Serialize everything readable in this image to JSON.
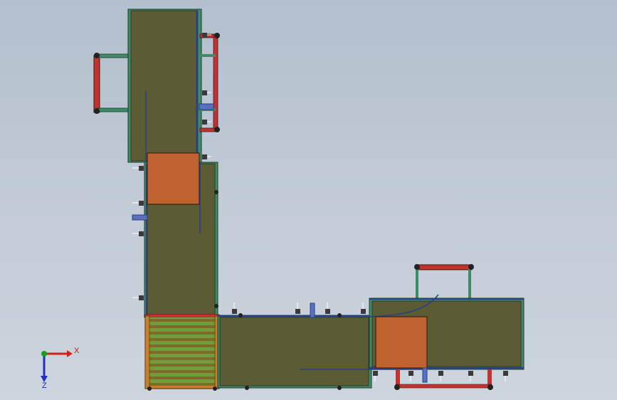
{
  "colors": {
    "background": "#bfc9d5",
    "conveyor_belt": "#5b5c33",
    "belt_edge": "#2f3a2a",
    "frame_rail": "#3f8a67",
    "side_guard": "#2a3f86",
    "transfer_pad": "#c0622f",
    "handle_frame": "#c2332f",
    "roller": "#6f9e3b",
    "roller_frame": "#c8812a",
    "axis_x": "#d62020",
    "axis_y": "#18a018",
    "axis_z": "#2030c0"
  },
  "triad": {
    "x_label": "X",
    "z_label": "Z"
  },
  "icons": {
    "axis_triad": "coordinate-triad-icon",
    "caster": "caster-wheel-icon"
  }
}
